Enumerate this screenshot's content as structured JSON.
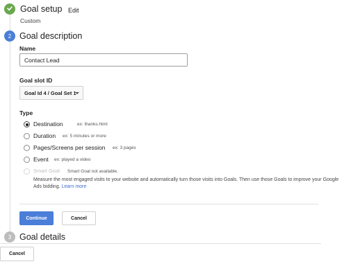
{
  "steps": {
    "setup": {
      "title": "Goal setup",
      "edit_label": "Edit",
      "subtitle": "Custom"
    },
    "description": {
      "number": "2",
      "title": "Goal description"
    },
    "details": {
      "number": "3",
      "title": "Goal details"
    }
  },
  "form": {
    "name_label": "Name",
    "name_value": "Contact Lead",
    "slot_label": "Goal slot ID",
    "slot_value": "Goal Id 4 / Goal Set 1",
    "type_label": "Type",
    "types": [
      {
        "label": "Destination",
        "hint": "ex: thanks.html",
        "checked": true,
        "disabled": false
      },
      {
        "label": "Duration",
        "hint": "ex: 5 minutes or more",
        "checked": false,
        "disabled": false
      },
      {
        "label": "Pages/Screens per session",
        "hint": "ex: 3 pages",
        "checked": false,
        "disabled": false
      },
      {
        "label": "Event",
        "hint": "ex: played a video",
        "checked": false,
        "disabled": false
      },
      {
        "label": "Smart Goal",
        "hint": "Smart Goal not available.",
        "checked": false,
        "disabled": true
      }
    ],
    "smart_goal_description": "Measure the most engaged visits to your website and automatically turn those visits into Goals. Then use those Goals to improve your Google Ads bidding.",
    "learn_more": "Learn more"
  },
  "buttons": {
    "continue": "Continue",
    "cancel": "Cancel",
    "bottom_cancel": "Cancel"
  },
  "colors": {
    "done": "#6aa84f",
    "active": "#4a7ed8",
    "pending": "#bdbdbd",
    "link": "#3b6bd6"
  },
  "icons": {
    "done": "check-icon"
  }
}
